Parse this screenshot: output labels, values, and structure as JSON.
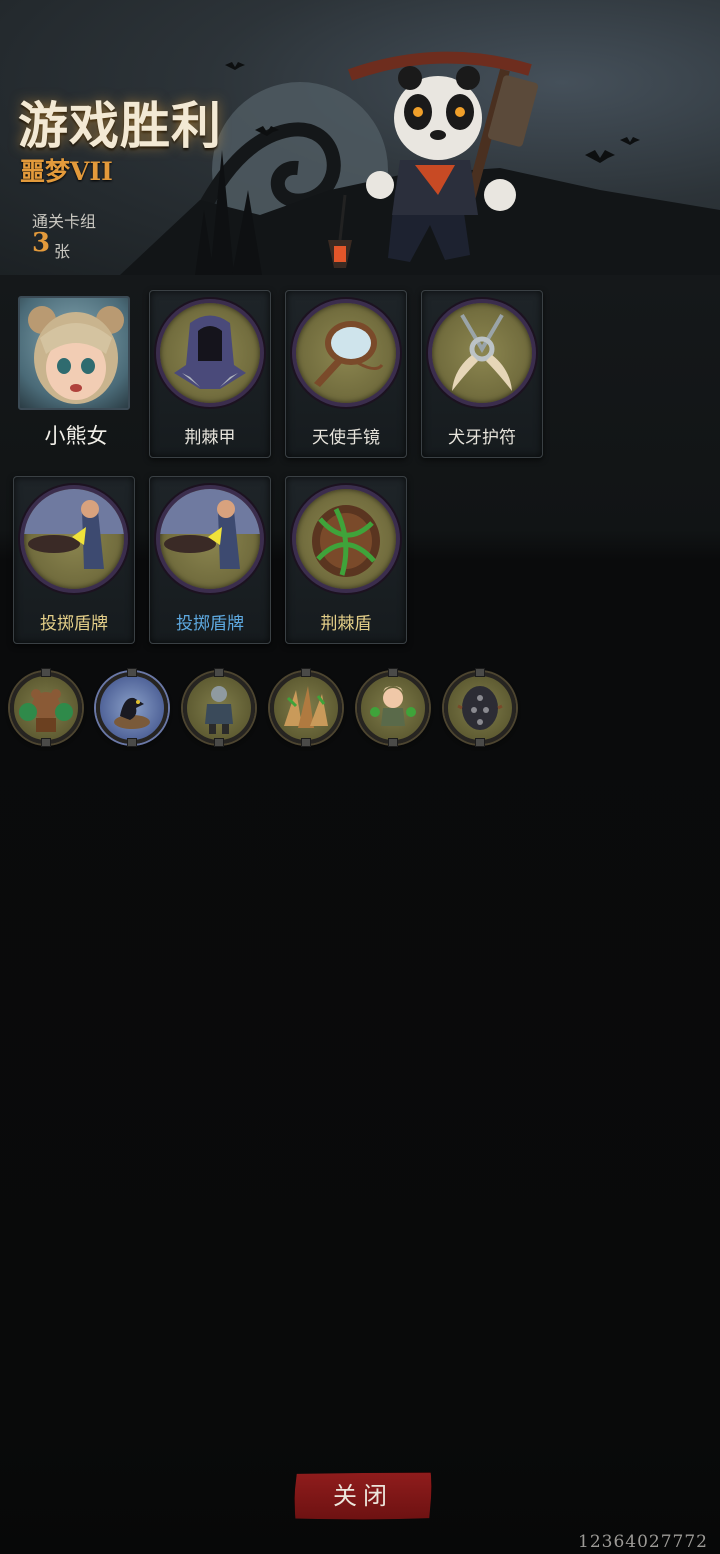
{
  "header": {
    "title": "游戏胜利",
    "difficulty": "噩梦VII",
    "deck_label": "通关卡组",
    "deck_count": "3",
    "deck_unit": "张"
  },
  "hero": {
    "name": "小熊女",
    "portrait_icon": "bear-girl-portrait-icon"
  },
  "cards_row1": [
    {
      "label": "荆棘甲",
      "icon": "hooded-armor-icon"
    },
    {
      "label": "天使手镜",
      "icon": "hand-mirror-icon"
    },
    {
      "label": "犬牙护符",
      "icon": "fang-amulet-icon"
    }
  ],
  "cards_row2": [
    {
      "label": "投掷盾牌",
      "icon": "shield-throw-icon"
    },
    {
      "label": "投掷盾牌",
      "icon": "shield-throw-icon",
      "upgraded": true
    },
    {
      "label": "荆棘盾",
      "icon": "thorn-shield-icon"
    }
  ],
  "relics": [
    {
      "icon": "bear-guardian-relic-icon"
    },
    {
      "icon": "crow-nest-relic-icon",
      "rare": true
    },
    {
      "icon": "armored-knight-relic-icon"
    },
    {
      "icon": "spikes-relic-icon"
    },
    {
      "icon": "girl-relic-icon"
    },
    {
      "icon": "spiked-shield-relic-icon"
    }
  ],
  "footer": {
    "close_label": "关闭",
    "build_id": "12364027772"
  },
  "colors": {
    "accent_orange": "#e39a3b",
    "upgrade_blue": "#5ea9e0",
    "close_red": "#8f1c1c"
  }
}
